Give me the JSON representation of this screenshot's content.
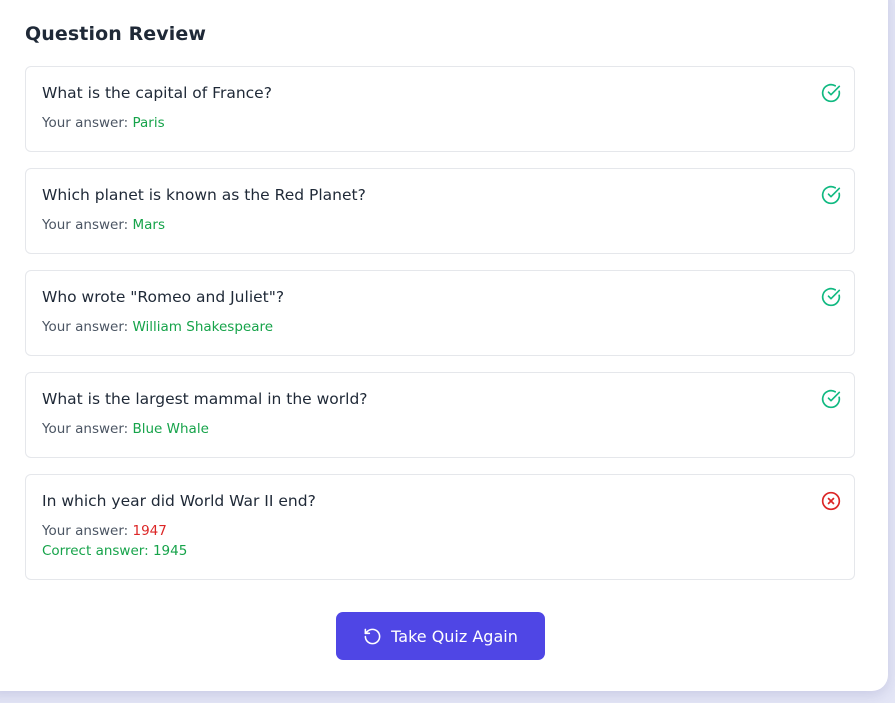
{
  "review": {
    "title": "Question Review",
    "answer_label": "Your answer:",
    "correct_label": "Correct answer:",
    "questions": [
      {
        "question": "What is the capital of France?",
        "your_answer": "Paris",
        "status": "correct"
      },
      {
        "question": "Which planet is known as the Red Planet?",
        "your_answer": "Mars",
        "status": "correct"
      },
      {
        "question": "Who wrote \"Romeo and Juliet\"?",
        "your_answer": "William Shakespeare",
        "status": "correct"
      },
      {
        "question": "What is the largest mammal in the world?",
        "your_answer": "Blue Whale",
        "status": "correct"
      },
      {
        "question": "In which year did World War II end?",
        "your_answer": "1947",
        "correct_answer": "1945",
        "status": "incorrect"
      }
    ]
  },
  "actions": {
    "retake_label": "Take Quiz Again",
    "retake_icon": "rotate-ccw-icon"
  },
  "colors": {
    "correct": "#16a34a",
    "correct_icon": "#10b981",
    "incorrect": "#dc2626",
    "accent": "#4f46e5",
    "background": "#e4e6f6"
  }
}
